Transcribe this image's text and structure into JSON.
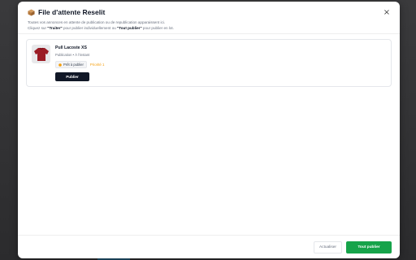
{
  "modal": {
    "title": "File d'attente Reselit",
    "subtitle_line1": "Toutes vos annonces en attente de publication ou de republication apparaissent ici.",
    "subtitle_line2_prefix": "Cliquez sur ",
    "subtitle_line2_treat": "\"Traiter\"",
    "subtitle_line2_mid": " pour publier individuellement ou ",
    "subtitle_line2_all": "\"Tout publier\"",
    "subtitle_line2_suffix": " pour publier en lot.",
    "close_label": "×",
    "title_icon": "package-icon"
  },
  "queue": {
    "items": [
      {
        "title": "Pull Lacoste XS",
        "meta": "Publication • À l'instant",
        "ready_label": "Prêt à publier",
        "priority_label": "Priorité 1",
        "publish_label": "Publier",
        "thumb_icon": "sweater-icon"
      }
    ]
  },
  "footer": {
    "refresh_label": "Actualiser",
    "publish_all_label": "Tout publier"
  },
  "colors": {
    "primary_dark": "#111827",
    "success": "#16a34a",
    "priority": "#f59e0b"
  }
}
